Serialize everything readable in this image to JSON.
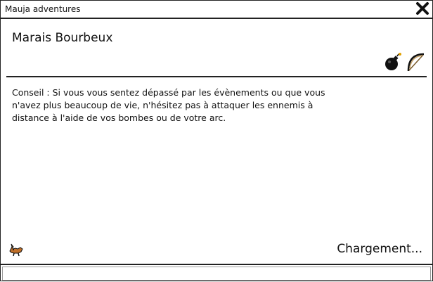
{
  "window": {
    "title": "Mauja adventures",
    "close_icon": "close-x-icon"
  },
  "location": {
    "name": "Marais Bourbeux"
  },
  "inventory": {
    "items": [
      {
        "icon": "bomb-icon"
      },
      {
        "icon": "bow-icon"
      }
    ]
  },
  "tip": {
    "text": "Conseil : Si vous vous sentez dépassé par les évènements ou que vous n'avez plus beaucoup de vie, n'hésitez pas à attaquer les ennemis à distance à l'aide de vos bombes ou de votre arc."
  },
  "status": {
    "loading_label": "Chargement...",
    "mascot_icon": "fox-icon"
  }
}
